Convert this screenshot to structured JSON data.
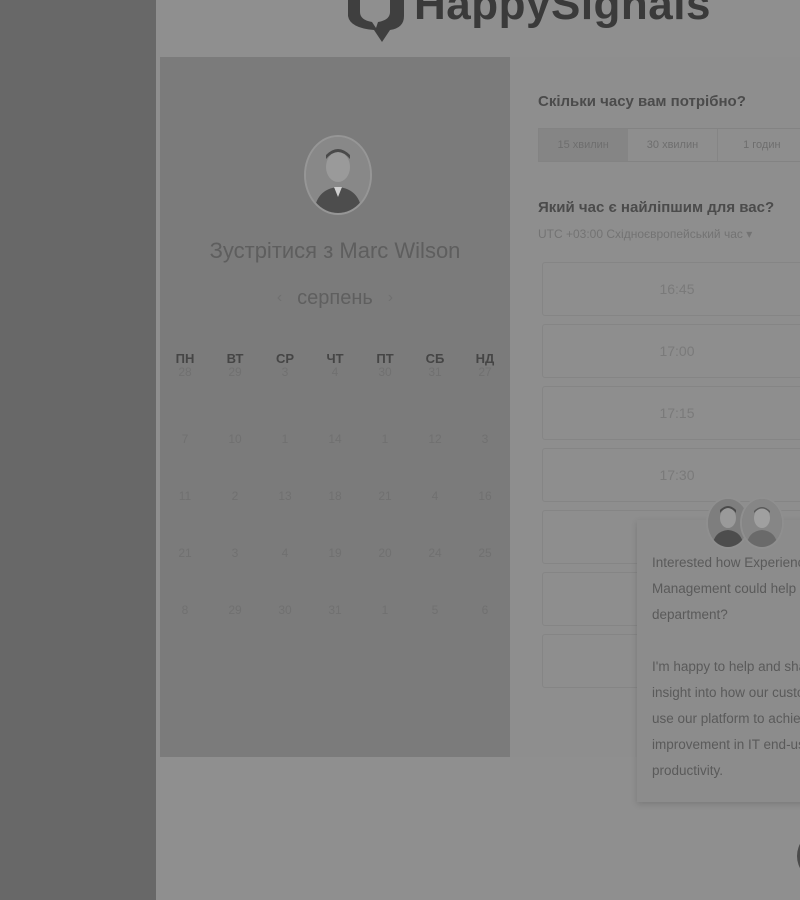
{
  "brand": {
    "logo_text": "HappySignals"
  },
  "organizer": {
    "title": "Зустрітися з Marc Wilson"
  },
  "calendar": {
    "month": "серпень",
    "weekdays": [
      "ПН",
      "ВТ",
      "СР",
      "ЧТ",
      "ПТ",
      "СБ",
      "НД"
    ],
    "weeks": [
      [
        "28",
        "29",
        "3",
        "4",
        "30",
        "31",
        "27"
      ],
      [
        "7",
        "10",
        "1",
        "14",
        "1",
        "12",
        "3"
      ],
      [
        "11",
        "2",
        "13",
        "18",
        "21",
        "4",
        "16"
      ],
      [
        "21",
        "3",
        "4",
        "19",
        "20",
        "24",
        "25"
      ],
      [
        "8",
        "29",
        "30",
        "31",
        "1",
        "5",
        "6"
      ]
    ]
  },
  "booking": {
    "duration_question": "Скільки часу вам потрібно?",
    "durations": [
      "15 хвилин",
      "30 хвилин",
      "1 годин"
    ],
    "time_question": "Який час є найліпшим для вас?",
    "timezone": "UTC +03:00 Східноєвропейський час ▾",
    "slots": [
      "16:45",
      "17:00",
      "17:15",
      "17:30",
      "",
      "",
      ""
    ]
  },
  "chat": {
    "message_1": "Interested how Experience Management could help your IT department?",
    "message_2": "I'm happy to help and share insight into how our customers use our platform to achieve improvement in IT end-user productivity."
  },
  "colors": {
    "overlay": "#8f8f8f",
    "left_panel": "#7b7b7b",
    "text_dark": "#4b4b4b"
  }
}
